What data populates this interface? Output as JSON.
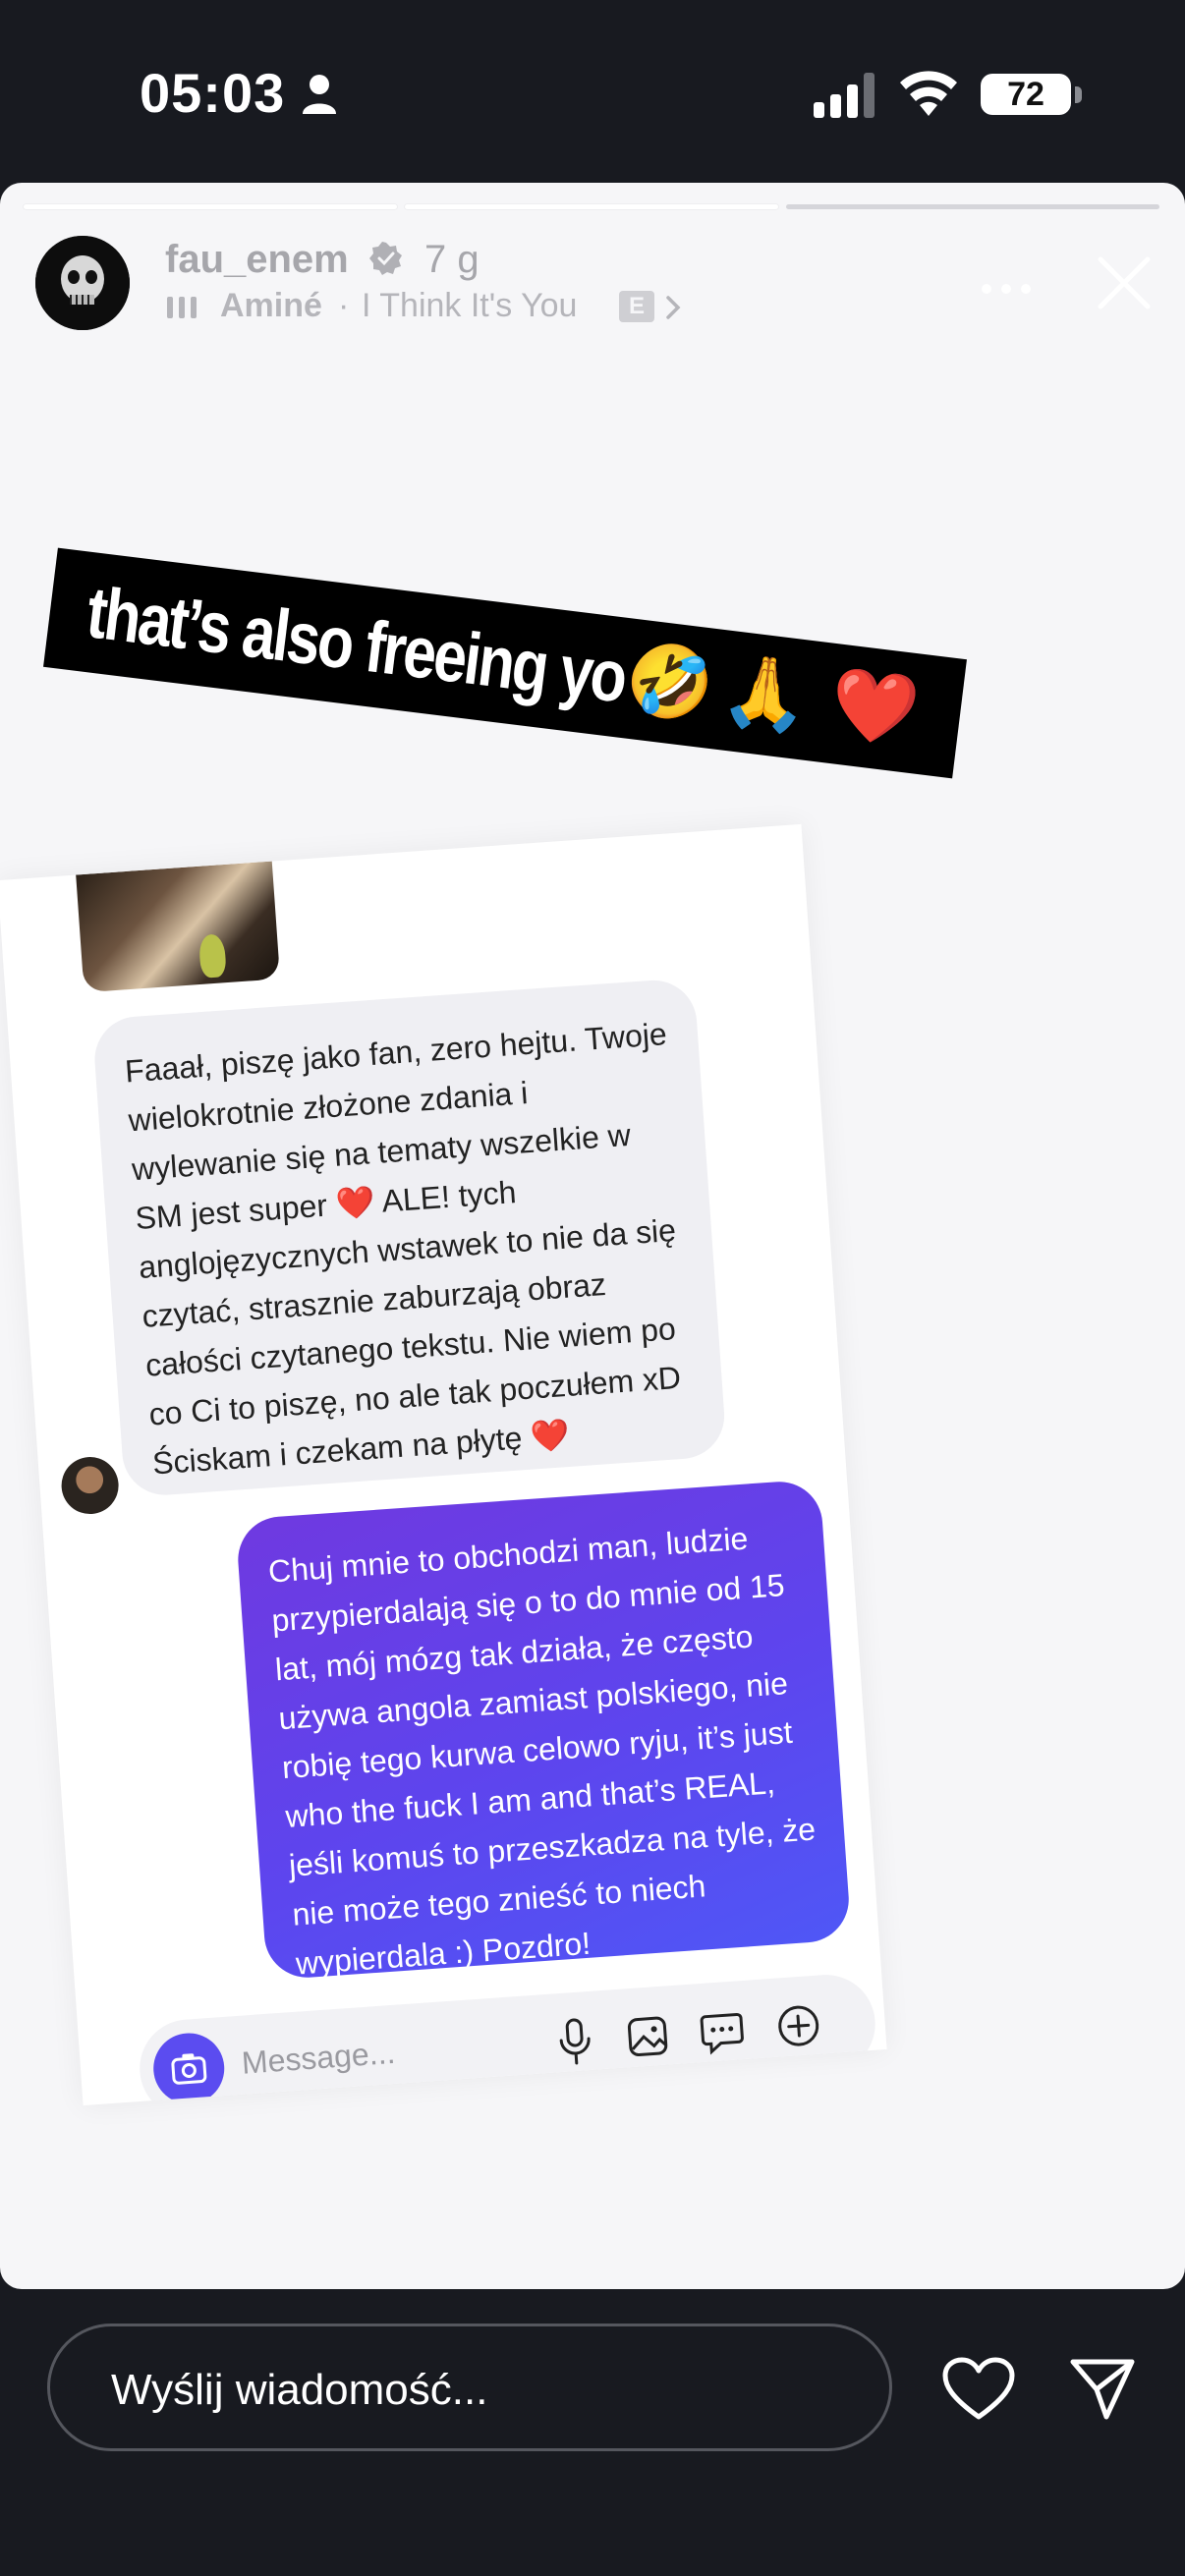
{
  "status_bar": {
    "time": "05:03",
    "battery": "72"
  },
  "story": {
    "username": "fau_enem",
    "time_ago": "7 g",
    "music": {
      "artist": "Aminé",
      "separator": "·",
      "title": "I Think It's You",
      "explicit": "E"
    },
    "progress": [
      {
        "state": "done"
      },
      {
        "state": "done"
      },
      {
        "state": "current"
      }
    ],
    "caption": {
      "text": "that’s also freeing yo",
      "emojis": [
        "🤣",
        "🙏",
        "❤️"
      ]
    },
    "dm": {
      "received_message": "Faaał, piszę jako fan, zero hejtu. Twoje wielokrotnie złożone zdania i wylewanie się na tematy wszelkie w SM jest super ❤️ ALE! tych anglojęzycznych wstawek to nie da się czytać, strasznie zaburzają obraz całości czytanego tekstu. Nie wiem po co Ci to piszę, no ale tak poczułem xD Ściskam i czekam na płytę ❤️",
      "sent_message": "Chuj mnie to obchodzi man, ludzie przypierdalają się o to do mnie od 15 lat, mój mózg tak działa, że często używa angola zamiast polskiego, nie robię tego kurwa celowo ryju, it’s just who the fuck I am and that’s REAL, jeśli komuś to przeszkadza na tyle, że nie może tego znieść to niech wypierdala :) Pozdro!",
      "composer_placeholder": "Message..."
    }
  },
  "reply": {
    "placeholder": "Wyślij wiadomość..."
  },
  "colors": {
    "background": "#181a20",
    "story_bg": "#f6f6f8",
    "sent_bubble": "#5d45ee",
    "received_bubble": "#efeff3"
  }
}
